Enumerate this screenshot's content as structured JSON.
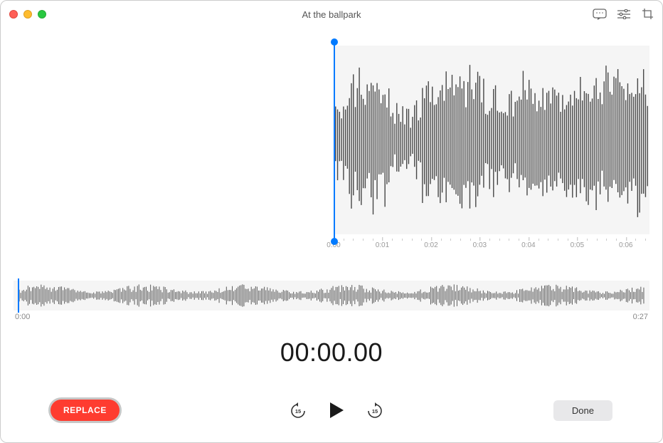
{
  "window": {
    "title": "At the ballpark"
  },
  "detail": {
    "ticks": [
      "0:00",
      "0:01",
      "0:02",
      "0:03",
      "0:04",
      "0:05",
      "0:06"
    ]
  },
  "overview": {
    "start_label": "0:00",
    "end_label": "0:27"
  },
  "counter": {
    "time": "00:00.00"
  },
  "controls": {
    "replace_label": "REPLACE",
    "skip_back_seconds": "15",
    "skip_forward_seconds": "15",
    "done_label": "Done"
  },
  "colors": {
    "accent": "#007aff",
    "record_red": "#fe3c30"
  }
}
